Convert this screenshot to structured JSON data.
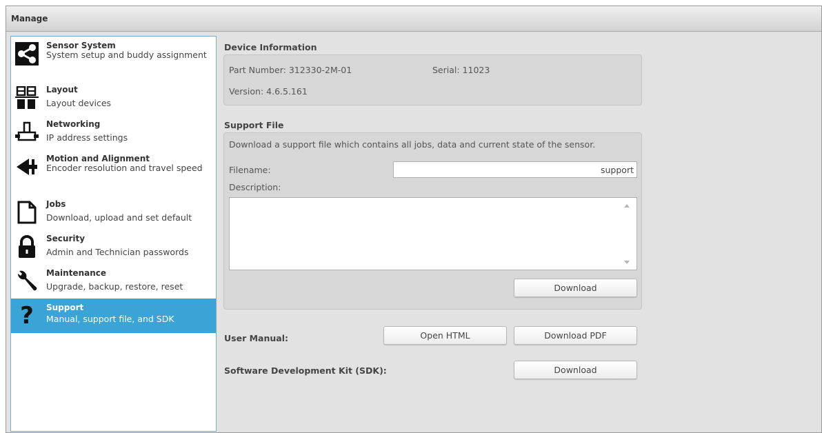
{
  "window": {
    "title": "Manage"
  },
  "sidebar": {
    "items": [
      {
        "title": "Sensor System",
        "desc": "System setup and buddy assignment",
        "icon": "share-network-icon"
      },
      {
        "title": "Layout",
        "desc": "Layout devices",
        "icon": "layout-grid-icon"
      },
      {
        "title": "Networking",
        "desc": "IP address settings",
        "icon": "network-connector-icon"
      },
      {
        "title": "Motion and Alignment",
        "desc": "Encoder resolution and travel speed",
        "icon": "encoder-arrow-icon"
      },
      {
        "title": "Jobs",
        "desc": "Download, upload and set default",
        "icon": "document-icon"
      },
      {
        "title": "Security",
        "desc": "Admin and Technician passwords",
        "icon": "lock-icon"
      },
      {
        "title": "Maintenance",
        "desc": "Upgrade, backup, restore, reset",
        "icon": "wrench-icon"
      },
      {
        "title": "Support",
        "desc": "Manual, support file, and SDK",
        "icon": "question-mark-icon",
        "active": true
      }
    ]
  },
  "device_info": {
    "heading": "Device Information",
    "part_number": "Part Number: 312330-2M-01",
    "serial": "Serial: 11023",
    "version": "Version: 4.6.5.161"
  },
  "support_file": {
    "heading": "Support File",
    "intro": "Download a support file which contains all jobs, data and current state of the sensor.",
    "filename_label": "Filename:",
    "filename_value": "support",
    "description_label": "Description:",
    "description_value": "",
    "download_label": "Download"
  },
  "user_manual": {
    "label": "User Manual:",
    "open_html_label": "Open HTML",
    "download_pdf_label": "Download PDF"
  },
  "sdk": {
    "label": "Software Development Kit (SDK):",
    "download_label": "Download"
  },
  "colors": {
    "accent": "#3ba4d6",
    "panel": "#d7d7d7",
    "background": "#e2e2e2"
  }
}
